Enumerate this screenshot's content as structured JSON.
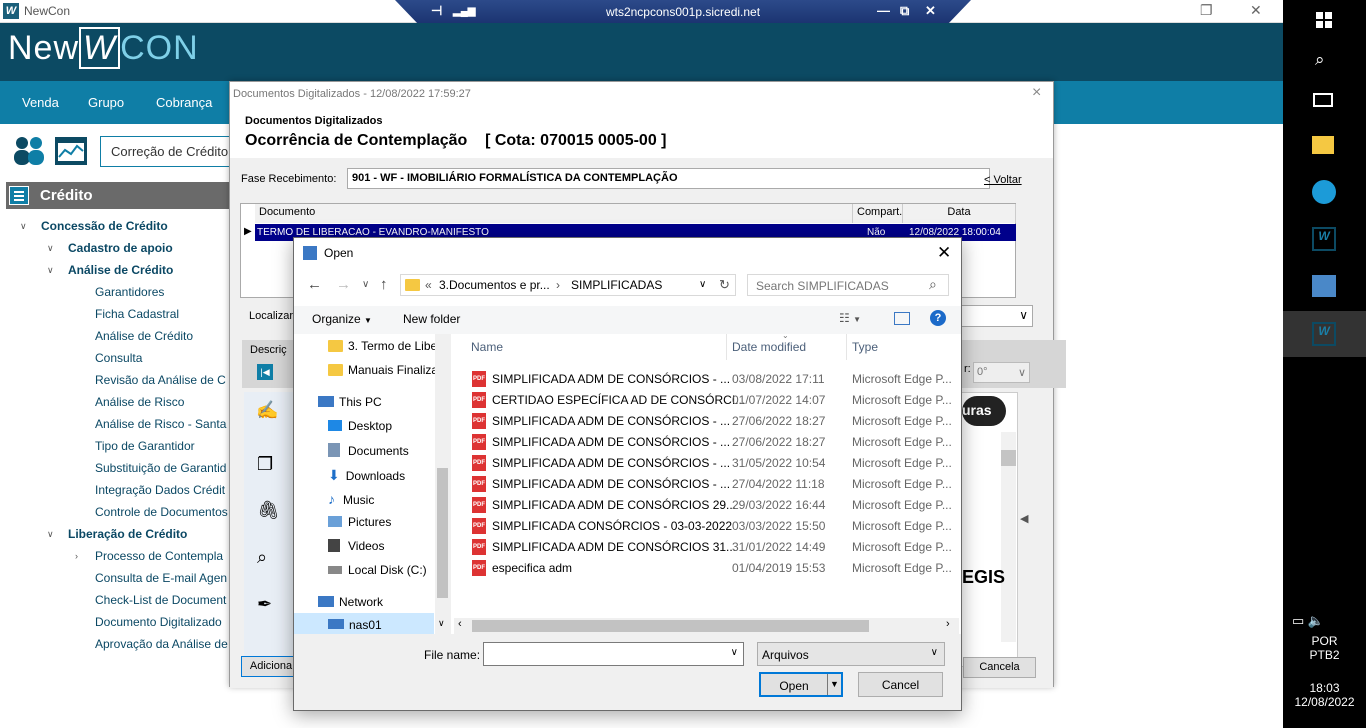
{
  "window": {
    "app_title": "NewCon",
    "rdp_host": "wts2ncpcons001p.sicredi.net"
  },
  "logo": {
    "part1": "New",
    "mark": "W",
    "part2": "CON"
  },
  "nav": {
    "items": [
      "Venda",
      "Grupo",
      "Cobrança"
    ]
  },
  "toolbar": {
    "correcao": "Correção de Crédito"
  },
  "sidebar": {
    "header": "Crédito",
    "concessao": "Concessão de Crédito",
    "cadastro": "Cadastro de apoio",
    "analise": "Análise de Crédito",
    "analise_items": [
      "Garantidores",
      "Ficha Cadastral",
      "Análise de Crédito",
      "Consulta",
      "Revisão da Análise de C",
      "Análise de Risco",
      "Análise de Risco - Santa",
      "Tipo de Garantidor",
      "Substituição de Garantid",
      "Integração Dados Crédit",
      "Controle de Documentos"
    ],
    "liberacao": "Liberação de Crédito",
    "liberacao_items": [
      "Processo de Contempla",
      "Consulta de E-mail Agen",
      "Check-List de Document",
      "Documento Digitalizado",
      "Aprovação da Análise de"
    ]
  },
  "docdialog": {
    "title": "Documentos Digitalizados - 12/08/2022  17:59:27",
    "subtitle": "Documentos Digitalizados",
    "heading": "Ocorrência de Contemplação    [ Cota: 070015 0005-00 ]",
    "fase_label": "Fase Recebimento:",
    "fase_value": "901 - WF - IMOBILIÁRIO FORMALÍSTICA DA CONTEMPLAÇÃO",
    "voltar": "< Voltar",
    "col_documento": "Documento",
    "col_compart": "Compart.",
    "col_data": "Data",
    "row_doc": "TERMO DE LIBERACAO - EVANDRO-MANIFESTO",
    "row_compart": "Não",
    "row_data": "12/08/2022 18:00:04",
    "localizar": "Localizar",
    "descricao": "Descriç",
    "zoom": "0°",
    "zoom_label": "r:",
    "pdf_btn": "uras",
    "regis": "EGIS",
    "adicionar": "Adiciona",
    "cancela": "Cancela"
  },
  "open": {
    "title": "Open",
    "path_prefix": "«",
    "path1": "3.Documentos e pr...",
    "path2": "SIMPLIFICADAS",
    "search_placeholder": "Search SIMPLIFICADAS",
    "organize": "Organize",
    "new_folder": "New folder",
    "nav_items": [
      "3. Termo de Libe",
      "Manuais Finaliza",
      "This PC",
      "Desktop",
      "Documents",
      "Downloads",
      "Music",
      "Pictures",
      "Videos",
      "Local Disk (C:)",
      "Network",
      "nas01"
    ],
    "col_name": "Name",
    "col_date": "Date modified",
    "col_type": "Type",
    "files": [
      {
        "name": "SIMPLIFICADA ADM DE CONSÓRCIOS - ...",
        "date": "03/08/2022 17:11",
        "type": "Microsoft Edge P..."
      },
      {
        "name": "CERTIDAO ESPECÍFICA AD DE CONSÓRCI...",
        "date": "01/07/2022 14:07",
        "type": "Microsoft Edge P..."
      },
      {
        "name": "SIMPLIFICADA ADM DE CONSÓRCIOS - ...",
        "date": "27/06/2022 18:27",
        "type": "Microsoft Edge P..."
      },
      {
        "name": "SIMPLIFICADA ADM DE CONSÓRCIOS - ...",
        "date": "27/06/2022 18:27",
        "type": "Microsoft Edge P..."
      },
      {
        "name": "SIMPLIFICADA ADM DE CONSÓRCIOS - ...",
        "date": "31/05/2022 10:54",
        "type": "Microsoft Edge P..."
      },
      {
        "name": "SIMPLIFICADA ADM DE CONSÓRCIOS - ...",
        "date": "27/04/2022 11:18",
        "type": "Microsoft Edge P..."
      },
      {
        "name": "SIMPLIFICADA ADM DE CONSÓRCIOS 29...",
        "date": "29/03/2022 16:44",
        "type": "Microsoft Edge P..."
      },
      {
        "name": "SIMPLIFICADA CONSÓRCIOS - 03-03-2022",
        "date": "03/03/2022 15:50",
        "type": "Microsoft Edge P..."
      },
      {
        "name": "SIMPLIFICADA ADM DE CONSÓRCIOS 31...",
        "date": "31/01/2022 14:49",
        "type": "Microsoft Edge P..."
      },
      {
        "name": "especifica adm",
        "date": "01/04/2019 15:53",
        "type": "Microsoft Edge P..."
      }
    ],
    "filename_label": "File name:",
    "filename_value": "",
    "filter": "Arquivos",
    "open_btn": "Open",
    "cancel_btn": "Cancel",
    "pdf_badge": "PDF"
  },
  "taskbar": {
    "lang1": "POR",
    "lang2": "PTB2",
    "time": "18:03",
    "date": "12/08/2022"
  }
}
